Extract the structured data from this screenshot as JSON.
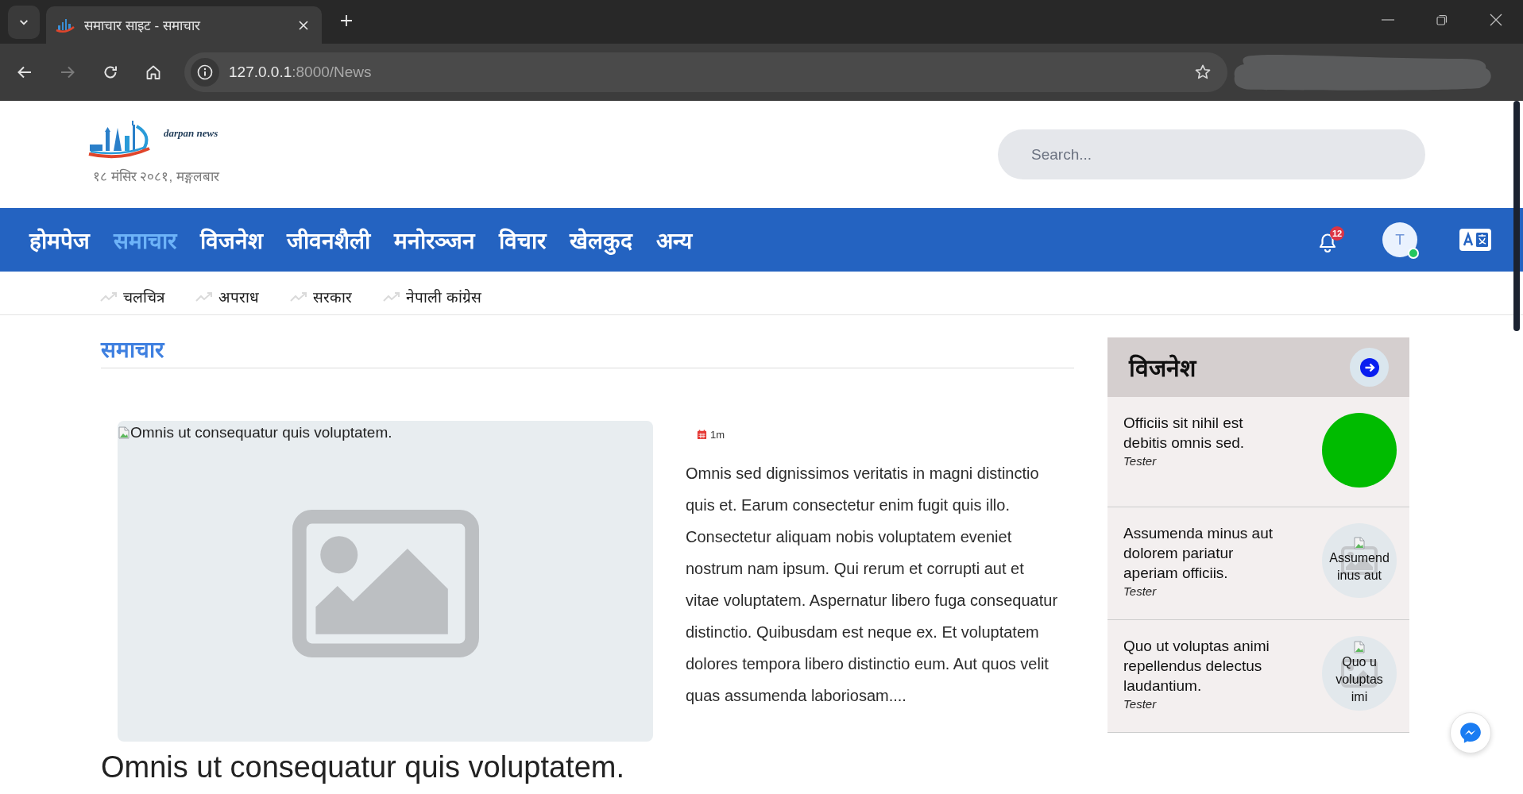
{
  "browser": {
    "tab": {
      "title": "समाचार साइट - समाचार"
    },
    "forward": {
      "disabled": true
    },
    "url": {
      "host": "127.0.0.1",
      "rest": ":8000/News"
    }
  },
  "header": {
    "logo_text": "darpan news",
    "date": "१८ मंसिर २०८१, मङ्गलबार",
    "search": {
      "placeholder": "Search..."
    }
  },
  "nav": {
    "items": [
      {
        "label": "होमपेज",
        "selected": false
      },
      {
        "label": "समाचार",
        "selected": true
      },
      {
        "label": "विजनेश",
        "selected": false
      },
      {
        "label": "जीवनशैली",
        "selected": false
      },
      {
        "label": "मनोरञ्जन",
        "selected": false
      },
      {
        "label": "विचार",
        "selected": false
      },
      {
        "label": "खेलकुद",
        "selected": false
      },
      {
        "label": "अन्य",
        "selected": false
      }
    ],
    "notifications": {
      "count": "12"
    },
    "user": {
      "initial": "T",
      "online": true
    }
  },
  "subnav": {
    "items": [
      {
        "label": "चलचित्र"
      },
      {
        "label": "अपराध"
      },
      {
        "label": "सरकार"
      },
      {
        "label": "नेपाली कांग्रेस"
      }
    ]
  },
  "section": {
    "title": "समाचार"
  },
  "article": {
    "image_alt": "Omnis ut consequatur quis voluptatem.",
    "time": "1m",
    "excerpt": "Omnis sed dignissimos veritatis in magni distinctio quis et. Earum consectetur enim fugit quis illo. Consectetur aliquam nobis voluptatem eveniet nostrum nam ipsum. Qui rerum et corrupti aut et vitae voluptatem. Aspernatur libero fuga consequatur distinctio. Quibusdam est neque ex. Et voluptatem dolores tempora libero distinctio eum. Aut quos velit quas assumenda laboriosam....",
    "title": "Omnis ut consequatur quis voluptatem."
  },
  "sidebar": {
    "title": "विजनेश",
    "items": [
      {
        "title": "Officiis sit nihil est debitis omnis sed.",
        "author": "Tester",
        "thumbnail": {
          "kind": "image"
        }
      },
      {
        "title": "Assumenda minus aut dolorem pariatur aperiam officiis.",
        "author": "Tester",
        "thumbnail": {
          "kind": "broken",
          "alt_lines": [
            "Assumend",
            "inus aut"
          ]
        }
      },
      {
        "title": "Quo ut voluptas animi repellendus delectus laudantium.",
        "author": "Tester",
        "thumbnail": {
          "kind": "broken",
          "alt_lines": [
            "Quo u",
            "voluptas",
            "imi"
          ]
        }
      }
    ]
  }
}
